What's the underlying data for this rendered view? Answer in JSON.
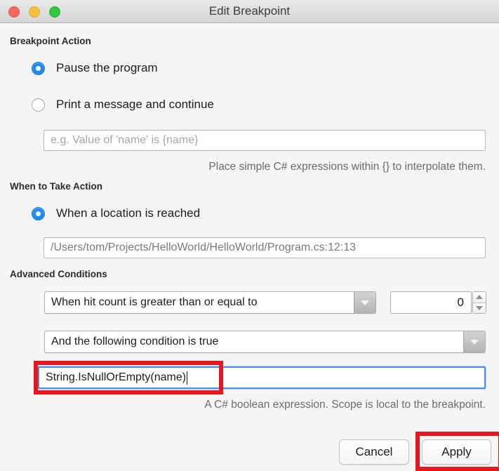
{
  "window": {
    "title": "Edit Breakpoint",
    "traffic_lights": [
      {
        "name": "close",
        "color": "#f9685f"
      },
      {
        "name": "minimize",
        "color": "#fbbe3f"
      },
      {
        "name": "maximize",
        "color": "#30c63f"
      }
    ]
  },
  "breakpoint_action": {
    "section_title": "Breakpoint Action",
    "options": [
      {
        "label": "Pause the program",
        "selected": true
      },
      {
        "label": "Print a message and continue",
        "selected": false
      }
    ],
    "message_field": {
      "value": "",
      "placeholder": "e.g. Value of 'name' is {name}"
    },
    "help_text": "Place simple C# expressions within {} to interpolate them."
  },
  "when_to_take_action": {
    "section_title": "When to Take Action",
    "options": [
      {
        "label": "When a location is reached",
        "selected": true
      }
    ],
    "location_field": {
      "value": "/Users/tom/Projects/HelloWorld/HelloWorld/Program.cs:12:13"
    }
  },
  "advanced_conditions": {
    "section_title": "Advanced Conditions",
    "hit_count": {
      "selected": "When hit count is greater than or equal to",
      "value": "0"
    },
    "condition": {
      "selected": "And the following condition is true",
      "expression": "String.IsNullOrEmpty(name)"
    },
    "help_text": "A C# boolean expression. Scope is local to the breakpoint."
  },
  "footer": {
    "cancel_label": "Cancel",
    "apply_label": "Apply"
  },
  "annotations": {
    "accent_color": "#e8161f",
    "highlighted": [
      "condition-expression-field",
      "apply-button"
    ]
  }
}
